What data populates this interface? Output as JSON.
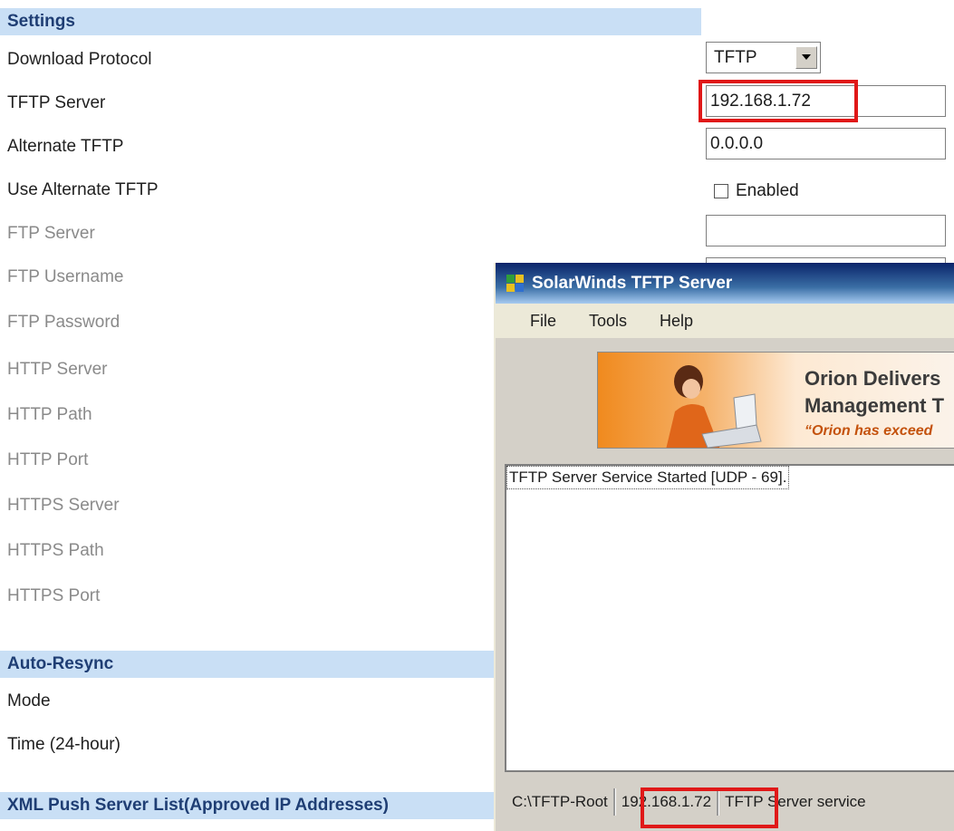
{
  "settings": {
    "header": "Settings",
    "rows": [
      {
        "label": "Download Protocol",
        "enabled": true
      },
      {
        "label": "TFTP Server",
        "enabled": true
      },
      {
        "label": "Alternate TFTP",
        "enabled": true
      },
      {
        "label": "Use Alternate TFTP",
        "enabled": true
      },
      {
        "label": "FTP Server",
        "enabled": false
      },
      {
        "label": "FTP Username",
        "enabled": false
      },
      {
        "label": "FTP Password",
        "enabled": false
      },
      {
        "label": "HTTP Server",
        "enabled": false
      },
      {
        "label": "HTTP Path",
        "enabled": false
      },
      {
        "label": "HTTP Port",
        "enabled": false
      },
      {
        "label": "HTTPS Server",
        "enabled": false
      },
      {
        "label": "HTTPS Path",
        "enabled": false
      },
      {
        "label": "HTTPS Port",
        "enabled": false
      }
    ],
    "download_protocol_value": "TFTP",
    "tftp_server_value": "192.168.1.72",
    "alternate_tftp_value": "0.0.0.0",
    "use_alternate_checkbox_label": "Enabled",
    "use_alternate_checked": false,
    "ftp_server_value": ""
  },
  "auto_resync": {
    "header": "Auto-Resync",
    "mode_label": "Mode",
    "time_label": "Time (24-hour)"
  },
  "xml_push": {
    "header": "XML Push Server List(Approved IP Addresses)"
  },
  "tftp_window": {
    "title": "SolarWinds TFTP Server",
    "menu": [
      "File",
      "Tools",
      "Help"
    ],
    "banner": {
      "line1": "Orion Delivers",
      "line2": "Management T",
      "quote": "“Orion has exceed"
    },
    "log": [
      "TFTP Server Service Started [UDP - 69]."
    ],
    "status": {
      "root": "C:\\TFTP-Root",
      "ip": "192.168.1.72",
      "service_text": "TFTP Server service"
    }
  },
  "colors": {
    "section_bar": "#c9dff5",
    "section_text": "#1f3e74",
    "highlight": "#e01818",
    "titlebar": "#0a246a"
  }
}
